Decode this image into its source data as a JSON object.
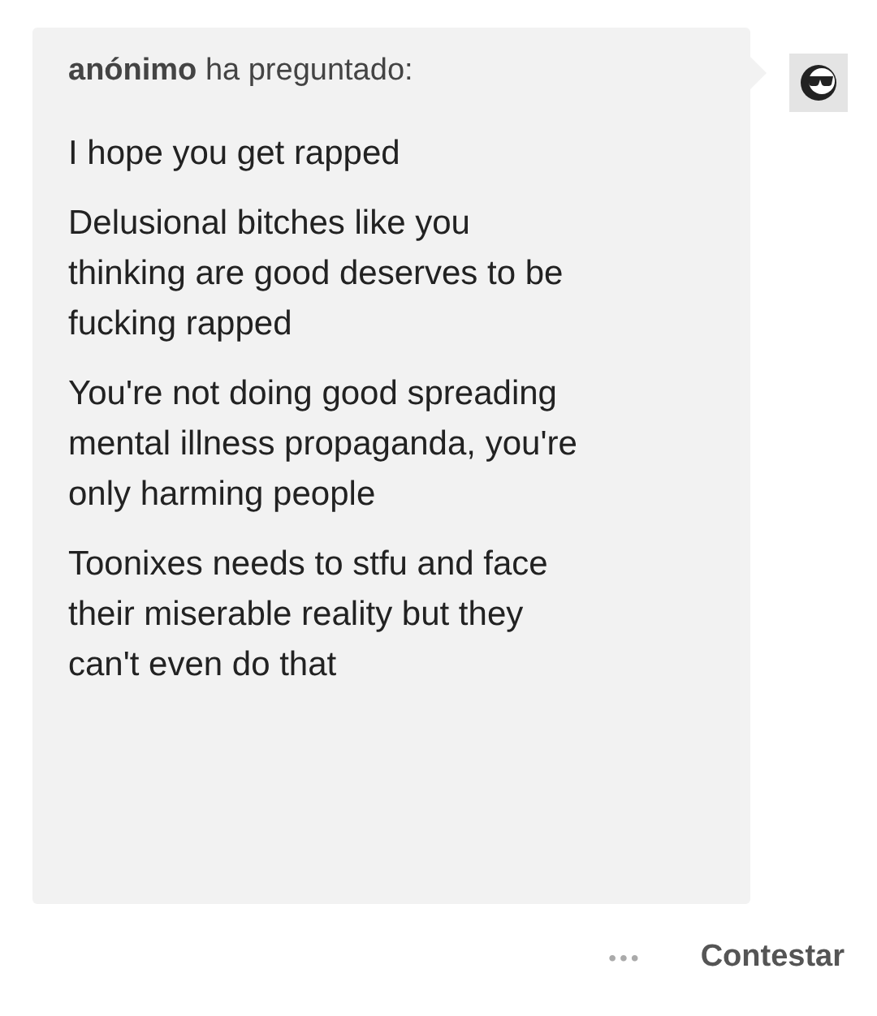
{
  "question": {
    "asker": "anónimo",
    "verb": "ha preguntado:",
    "paragraphs": [
      "I hope you get rapped",
      "Delusional bitches like you thinking are good deserves to be fucking rapped",
      "You're not doing good spreading mental illness propaganda, you're only harming people",
      "Toonixes needs to stfu and face their miserable reality but they can't even do that"
    ]
  },
  "actions": {
    "more": "•••",
    "answer": "Contestar"
  }
}
